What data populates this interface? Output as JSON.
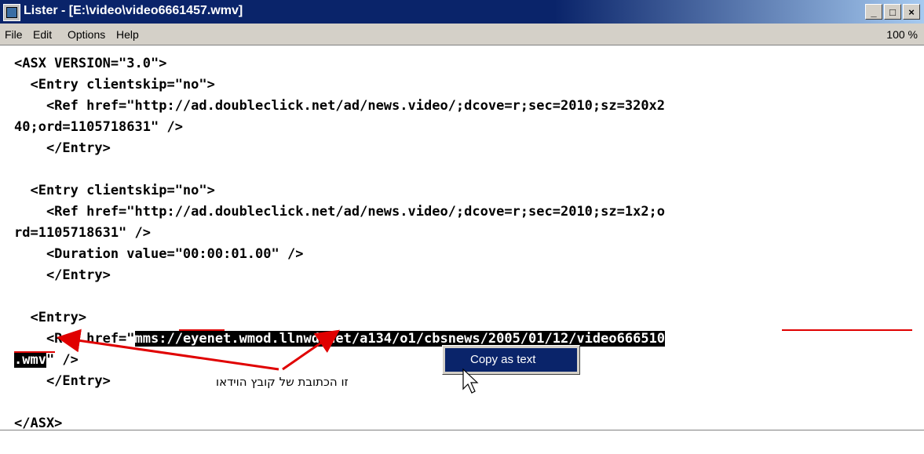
{
  "window": {
    "title": "Lister - [E:\\video\\video6661457.wmv]"
  },
  "window_buttons": [
    "_",
    "□",
    "×"
  ],
  "menu": {
    "items": [
      "File",
      "Edit",
      "Options",
      "Help"
    ],
    "zoom": "100 %"
  },
  "content": {
    "lines": [
      "<ASX VERSION=\"3.0\">",
      "  <Entry clientskip=\"no\">",
      "    <Ref href=\"http://ad.doubleclick.net/ad/news.video/;dcove=r;sec=2010;sz=320x2",
      "40;ord=1105718631\" />",
      "    </Entry>",
      "",
      "  <Entry clientskip=\"no\">",
      "    <Ref href=\"http://ad.doubleclick.net/ad/news.video/;dcove=r;sec=2010;sz=1x2;o",
      "rd=1105718631\" />",
      "    <Duration value=\"00:00:01.00\" />",
      "    </Entry>",
      "",
      "  <Entry>"
    ],
    "ref_prefix": "    <Ref href=\"",
    "selected_url_part1": "mms://eyenet.wmod.llnwd.net/a134/o1/cbsnews/2005/01/12/video666510",
    "selected_url_part2": ".wmv",
    "ref_suffix": "\" />",
    "entry_close": "    </Entry>",
    "blank": "",
    "asx_close": "</ASX>"
  },
  "context_menu": {
    "item": "Copy as text"
  },
  "annotation": {
    "text": "זו הכתובת של קובץ הוידאו",
    "color": "#e00000"
  },
  "colors": {
    "title_bar": "#0a246a",
    "selection": "#000000",
    "annotation": "#e00000",
    "menu_highlight": "#0a246a"
  }
}
